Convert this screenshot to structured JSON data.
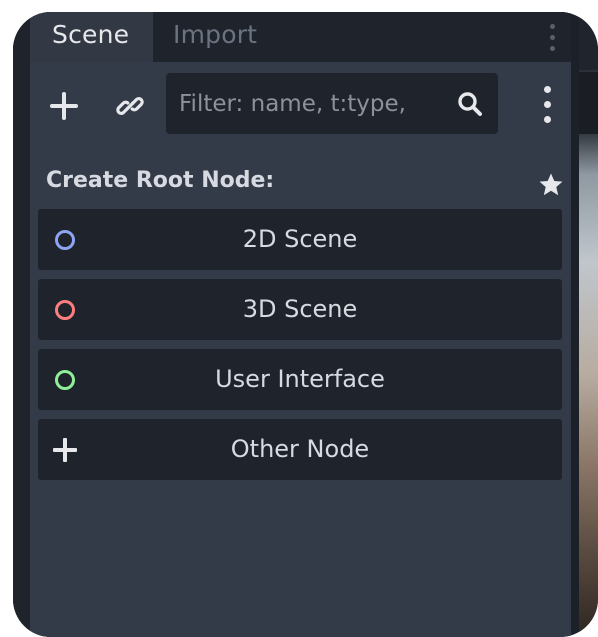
{
  "tabs": {
    "scene": "Scene",
    "import": "Import"
  },
  "toolbar": {
    "add_icon": "plus-icon",
    "link_icon": "link-icon",
    "filter_placeholder": "Filter: name, t:type,",
    "search_icon": "search-icon",
    "menu_icon": "vertical-dots-icon"
  },
  "create_root": {
    "title": "Create Root Node:",
    "favorite_icon": "star-icon",
    "options": [
      {
        "label": "2D Scene",
        "icon": "circle-icon",
        "color": "#8da5f3"
      },
      {
        "label": "3D Scene",
        "icon": "circle-icon",
        "color": "#fc7f7f"
      },
      {
        "label": "User Interface",
        "icon": "circle-icon",
        "color": "#8eef97"
      },
      {
        "label": "Other Node",
        "icon": "plus-icon",
        "color": "#e6e8ec"
      }
    ]
  },
  "colors": {
    "panel_bg": "#343b48",
    "button_bg": "#1f232b",
    "text": "#d7dae0"
  }
}
